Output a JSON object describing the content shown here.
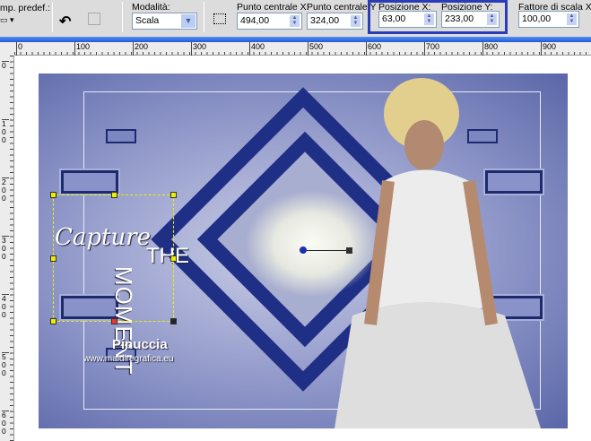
{
  "toolbar": {
    "preset_label": "mp. predef.:",
    "mode_label": "Modalità:",
    "mode_value": "Scala",
    "center_x_label": "Punto centrale X:",
    "center_x_value": "494,00",
    "center_y_label": "Punto centrale Y",
    "center_y_value": "324,00",
    "pos_x_label": "Posizione X:",
    "pos_x_value": "63,00",
    "pos_y_label": "Posizione Y:",
    "pos_y_value": "233,00",
    "scale_x_label": "Fattore di scala X (%",
    "scale_x_value": "100,00"
  },
  "rulers": {
    "horizontal": [
      "0",
      "100",
      "200",
      "300",
      "400",
      "500",
      "600",
      "700",
      "800",
      "900"
    ],
    "vertical": [
      "0",
      "100",
      "200",
      "300",
      "400",
      "500",
      "600"
    ]
  },
  "artwork": {
    "title_script": "Capture",
    "title_the": "THE",
    "title_moment": "MOMENT",
    "author": "Pinuccia",
    "website": "www.maidiregrafica.eu"
  },
  "colors": {
    "accent": "#2a3db4",
    "diamond": "#1f2f86"
  }
}
